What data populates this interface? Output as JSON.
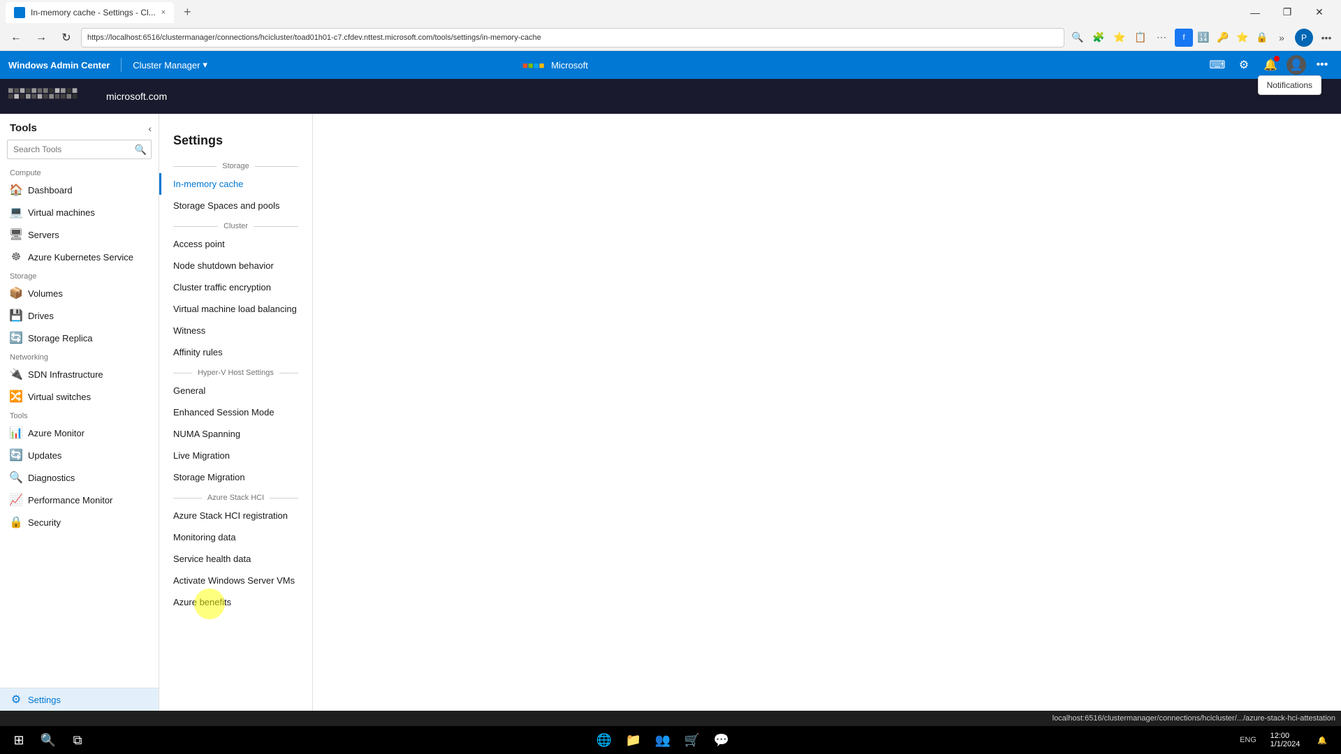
{
  "browser": {
    "tab_title": "In-memory cache - Settings - Cl...",
    "tab_close": "×",
    "new_tab": "+",
    "address_url": "https://localhost:6516/clustermanager/connections/hcicluster/toad01h01-c7.cfdev.nttest.microsoft.com/tools/settings/in-memory-cache",
    "back": "←",
    "forward": "→",
    "refresh": "↻",
    "win_minimize": "—",
    "win_maximize": "❐",
    "win_close": "✕"
  },
  "wac_header": {
    "app_name": "Windows Admin Center",
    "divider": "|",
    "cluster_name": "Cluster Manager",
    "ms_logo": "Microsoft",
    "terminal_icon": "⌨",
    "settings_icon": "⚙",
    "notif_icon": "🔔",
    "profile_icon": "👤",
    "more_icon": "•••"
  },
  "notifications_popup": {
    "text": "Notifications"
  },
  "page_logo": {
    "domain": "microsoft.com"
  },
  "sidebar": {
    "title": "Tools",
    "search_placeholder": "Search Tools",
    "sections": [
      {
        "label": "Compute",
        "items": [
          {
            "icon": "🖥",
            "label": "Dashboard",
            "active": false
          },
          {
            "icon": "💻",
            "label": "Virtual machines",
            "active": false
          },
          {
            "icon": "🖥",
            "label": "Servers",
            "active": false
          },
          {
            "icon": "☸",
            "label": "Azure Kubernetes Service",
            "active": false
          }
        ]
      },
      {
        "label": "Storage",
        "items": [
          {
            "icon": "📦",
            "label": "Volumes",
            "active": false
          },
          {
            "icon": "💾",
            "label": "Drives",
            "active": false
          },
          {
            "icon": "🔄",
            "label": "Storage Replica",
            "active": false
          }
        ]
      },
      {
        "label": "Networking",
        "items": [
          {
            "icon": "🔌",
            "label": "SDN Infrastructure",
            "active": false
          },
          {
            "icon": "🔀",
            "label": "Virtual switches",
            "active": false
          }
        ]
      },
      {
        "label": "Tools",
        "items": [
          {
            "icon": "📊",
            "label": "Azure Monitor",
            "active": false
          },
          {
            "icon": "🔄",
            "label": "Updates",
            "active": false
          },
          {
            "icon": "🔍",
            "label": "Diagnostics",
            "active": false
          },
          {
            "icon": "📈",
            "label": "Performance Monitor",
            "active": false
          },
          {
            "icon": "🔒",
            "label": "Security",
            "active": false
          }
        ]
      }
    ],
    "bottom_item": {
      "icon": "⚙",
      "label": "Settings",
      "active": true
    }
  },
  "settings": {
    "title": "Settings",
    "sections": [
      {
        "label": "Storage",
        "items": [
          {
            "label": "In-memory cache",
            "active": true
          },
          {
            "label": "Storage Spaces and pools",
            "active": false
          }
        ]
      },
      {
        "label": "Cluster",
        "items": [
          {
            "label": "Access point",
            "active": false
          },
          {
            "label": "Node shutdown behavior",
            "active": false
          },
          {
            "label": "Cluster traffic encryption",
            "active": false
          },
          {
            "label": "Virtual machine load balancing",
            "active": false
          },
          {
            "label": "Witness",
            "active": false
          },
          {
            "label": "Affinity rules",
            "active": false
          }
        ]
      },
      {
        "label": "Hyper-V Host Settings",
        "items": [
          {
            "label": "General",
            "active": false
          },
          {
            "label": "Enhanced Session Mode",
            "active": false
          },
          {
            "label": "NUMA Spanning",
            "active": false
          },
          {
            "label": "Live Migration",
            "active": false
          },
          {
            "label": "Storage Migration",
            "active": false
          }
        ]
      },
      {
        "label": "Azure Stack HCI",
        "items": [
          {
            "label": "Azure Stack HCI registration",
            "active": false
          },
          {
            "label": "Monitoring data",
            "active": false
          },
          {
            "label": "Service health data",
            "active": false
          },
          {
            "label": "Activate Windows Server VMs",
            "active": false
          },
          {
            "label": "Azure benefits",
            "active": false
          }
        ]
      }
    ]
  },
  "status_bar": {
    "url": "localhost:6516/clustermanager/connections/hcicluster/.../azure-stack-hci-attestation"
  },
  "taskbar": {
    "start_icon": "⊞",
    "search_icon": "🔍",
    "task_view": "⧉",
    "widgets": "⊟",
    "chat": "💬",
    "edge": "🌐",
    "explorer": "📁",
    "store": "🛒",
    "teams": "👥"
  }
}
